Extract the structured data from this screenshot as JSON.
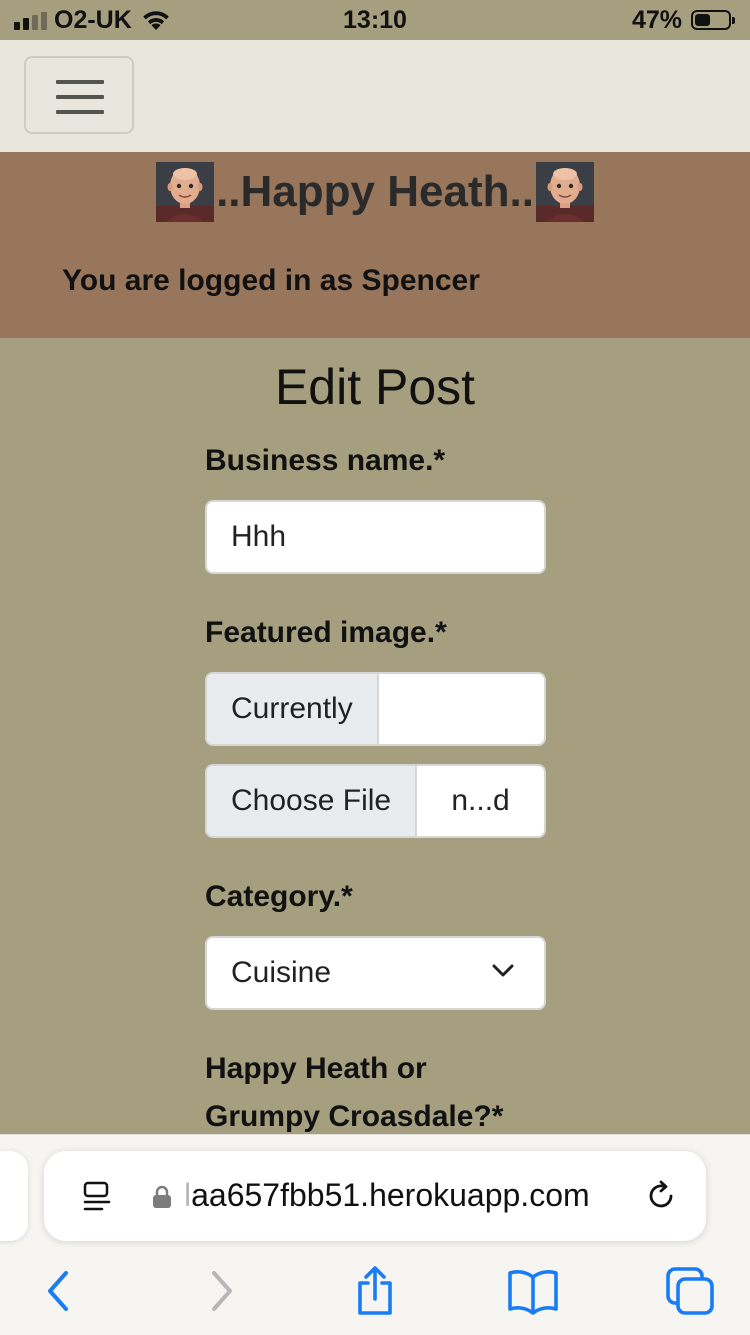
{
  "status_bar": {
    "carrier": "O2-UK",
    "time": "13:10",
    "battery_percent": "47%",
    "battery_level": 0.47,
    "signal_bars_active": 2,
    "signal_bars_total": 4
  },
  "navbar": {
    "toggler_icon": "hamburger-menu-icon"
  },
  "header": {
    "brand": "..Happy Heath..",
    "avatar_icon": "bald-man-avatar",
    "logged_in_text": "You are logged in as Spencer"
  },
  "form": {
    "title": "Edit Post",
    "business_name_label": "Business name.*",
    "business_name_value": "Hhh",
    "featured_image_label": "Featured image.*",
    "currently_label": "Currently",
    "currently_value": "",
    "choose_file_label": "Choose File",
    "chosen_file_text": "n...d",
    "category_label": "Category.*",
    "category_selected": "Cuisine",
    "happy_or_grumpy_label_line1": "Happy Heath or",
    "happy_or_grumpy_label_line2": "Grumpy Croasdale?*"
  },
  "browser": {
    "url_faded_prefix": "l",
    "url": "aa657fbb51.herokuapp.com",
    "icons": {
      "reader": "reader-mode-icon",
      "lock": "lock-icon",
      "reload": "reload-icon",
      "back": "back-arrow-icon",
      "forward": "forward-arrow-icon",
      "share": "share-icon",
      "bookmarks": "bookmarks-icon",
      "tabs": "tabs-icon"
    },
    "colors": {
      "accent": "#1a7cf5",
      "disabled": "#b7b7b7"
    }
  },
  "colors": {
    "page_background": "#a69f7f",
    "navbar_background": "#e9e7dd",
    "banner_background": "#98765c"
  }
}
